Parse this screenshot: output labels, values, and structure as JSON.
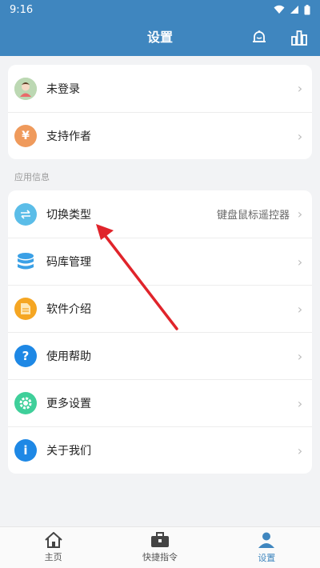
{
  "statusbar": {
    "time": "9:16"
  },
  "header": {
    "title": "设置"
  },
  "account_card": {
    "items": [
      {
        "label": "未登录"
      },
      {
        "label": "支持作者"
      }
    ]
  },
  "section_label": "应用信息",
  "info_card": {
    "items": [
      {
        "label": "切换类型",
        "value": "键盘鼠标遥控器"
      },
      {
        "label": "码库管理"
      },
      {
        "label": "软件介绍"
      },
      {
        "label": "使用帮助"
      },
      {
        "label": "更多设置"
      },
      {
        "label": "关于我们"
      }
    ]
  },
  "tabs": [
    {
      "label": "主页",
      "icon": "home-icon"
    },
    {
      "label": "快捷指令",
      "icon": "toolbox-icon"
    },
    {
      "label": "设置",
      "icon": "person-icon",
      "active": true
    }
  ],
  "colors": {
    "primary": "#3f86bf",
    "annotation_arrow": "#e0242b"
  },
  "support_icon_glyph": "¥"
}
